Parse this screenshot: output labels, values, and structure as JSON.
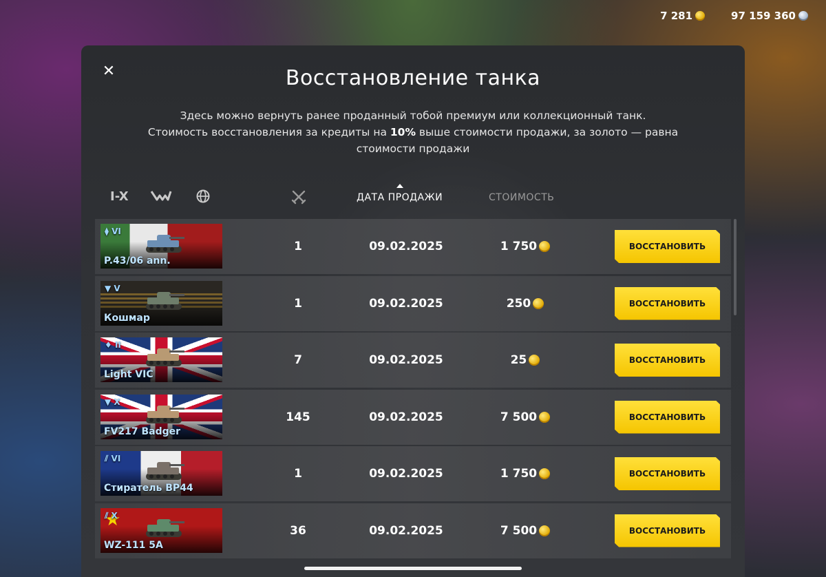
{
  "currency": {
    "gold": "7 281",
    "credits": "97 159 360"
  },
  "dialog": {
    "title": "Восстановление танка",
    "desc_line1": "Здесь можно вернуть ранее проданный тобой премиум или коллекционный танк.",
    "desc_line2_before": "Стоимость восстановления за кредиты на ",
    "desc_line2_bold": "10%",
    "desc_line2_after": " выше стоимости продажи, за золото — равна стоимости продажи"
  },
  "filters": {
    "tier_filter": "I-X",
    "type_icon": "tank-type-filter-icon",
    "nation_icon": "globe-icon",
    "battles_icon": "crossed-swords-icon",
    "sort_date": "ДАТА ПРОДАЖИ",
    "sort_cost": "СТОИМОСТЬ"
  },
  "colors": {
    "accent": "#f5c500",
    "tank_name": "#bfe4ff"
  },
  "rows": [
    {
      "tier": "VI",
      "name": "P.43/06 ann.",
      "battles": "1",
      "date": "09.02.2025",
      "cost": "1 750",
      "button": "ВОССТАНОВИТЬ",
      "flag": "it",
      "marker": "double-diamond"
    },
    {
      "tier": "V",
      "name": "Кошмар",
      "battles": "1",
      "date": "09.02.2025",
      "cost": "250",
      "button": "ВОССТАНОВИТЬ",
      "flag": "ru-dark",
      "marker": "triangle-down"
    },
    {
      "tier": "II",
      "name": "Light VIC",
      "battles": "7",
      "date": "09.02.2025",
      "cost": "25",
      "button": "ВОССТАНОВИТЬ",
      "flag": "uk",
      "marker": "diamond"
    },
    {
      "tier": "X",
      "name": "FV217 Badger",
      "battles": "145",
      "date": "09.02.2025",
      "cost": "7 500",
      "button": "ВОССТАНОВИТЬ",
      "flag": "uk",
      "marker": "triangle-down"
    },
    {
      "tier": "VI",
      "name": "Стиратель BP44",
      "battles": "1",
      "date": "09.02.2025",
      "cost": "1 750",
      "button": "ВОССТАНОВИТЬ",
      "flag": "fr",
      "marker": "double-slash"
    },
    {
      "tier": "X",
      "name": "WZ-111 5A",
      "battles": "36",
      "date": "09.02.2025",
      "cost": "7 500",
      "button": "ВОССТАНОВИТЬ",
      "flag": "cn",
      "marker": "double-slash"
    }
  ]
}
